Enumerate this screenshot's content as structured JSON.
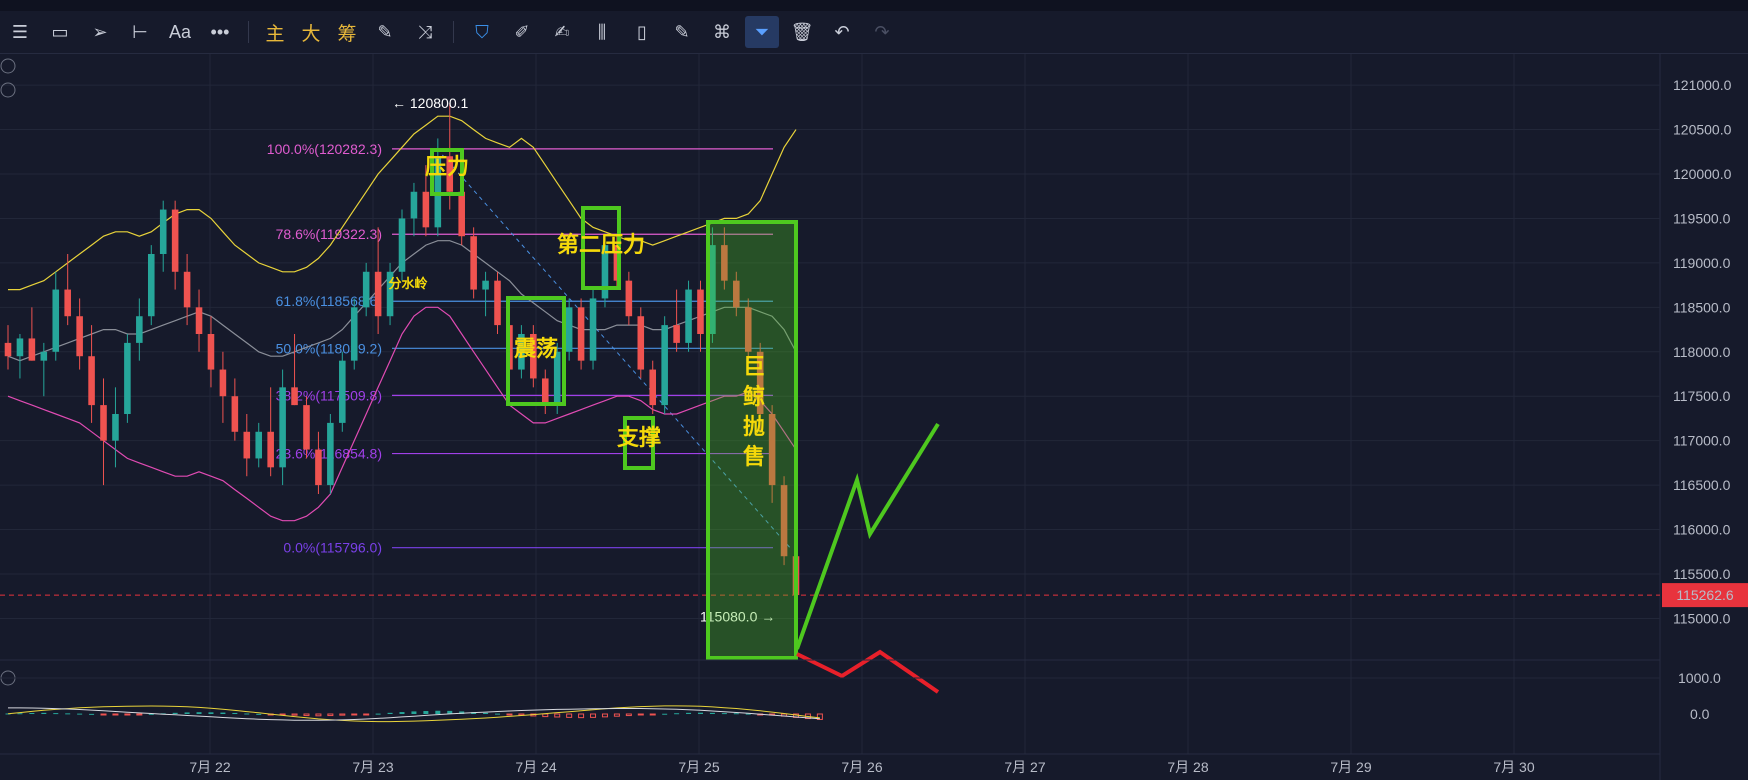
{
  "toolbar": {
    "items": [
      {
        "icon": "menu-icon",
        "glyph": "☰"
      },
      {
        "icon": "rectangle-icon",
        "glyph": "▭"
      },
      {
        "icon": "cursor-icon",
        "glyph": "➢"
      },
      {
        "icon": "horizontal-line-icon",
        "glyph": "⊢"
      },
      {
        "icon": "text-tool-icon",
        "glyph": "Aa"
      },
      {
        "icon": "more-icon",
        "glyph": "•••"
      }
    ],
    "cn_items": [
      {
        "icon": "main-indicator-icon",
        "glyph": "主"
      },
      {
        "icon": "large-indicator-icon",
        "glyph": "大"
      },
      {
        "icon": "chips-indicator-icon",
        "glyph": "筹"
      }
    ],
    "tools": [
      {
        "icon": "edit-indicator-icon",
        "glyph": "✎",
        "state": "normal"
      },
      {
        "icon": "draw-tool-icon",
        "glyph": "⤨",
        "state": "normal"
      },
      {
        "icon": "bookmark-icon",
        "glyph": "⛉",
        "state": "blue"
      },
      {
        "icon": "ruler-icon",
        "glyph": "✐",
        "state": "normal"
      },
      {
        "icon": "pen-icon",
        "glyph": "✍",
        "state": "normal"
      },
      {
        "icon": "candles-icon",
        "glyph": "⫼",
        "state": "normal"
      },
      {
        "icon": "clipboard-icon",
        "glyph": "▯",
        "state": "normal"
      },
      {
        "icon": "note-icon",
        "glyph": "✎",
        "state": "normal"
      },
      {
        "icon": "magnet-icon",
        "glyph": "⌘",
        "state": "normal"
      },
      {
        "icon": "filter-icon",
        "glyph": "⏷",
        "state": "active"
      },
      {
        "icon": "trash-icon",
        "glyph": "🗑",
        "state": "normal"
      },
      {
        "icon": "undo-icon",
        "glyph": "↶",
        "state": "normal"
      },
      {
        "icon": "redo-icon",
        "glyph": "↷",
        "state": "dim"
      }
    ]
  },
  "colors": {
    "bg": "#161a2b",
    "grid": "#222739",
    "up": "#26a69a",
    "down": "#ef5350",
    "boll_upper": "#e8d33a",
    "boll_mid": "#8b8f99",
    "boll_lower": "#e04bb3",
    "annot_box": "#4ec81f",
    "annot_text": "#f5d90a",
    "red_path": "#e8202a",
    "price_tag": "#e8333d"
  },
  "chart_data": {
    "type": "candlestick",
    "ylim": [
      114600,
      121350
    ],
    "yticks": [
      115000.0,
      115500.0,
      116000.0,
      116500.0,
      117000.0,
      117500.0,
      118000.0,
      118500.0,
      119000.0,
      119500.0,
      120000.0,
      120500.0,
      121000.0
    ],
    "ytick_labels": [
      "115000.0",
      "115500.0",
      "116000.0",
      "116500.0",
      "117000.0",
      "117500.0",
      "118000.0",
      "118500.0",
      "119000.0",
      "119500.0",
      "120000.0",
      "120500.0",
      "121000.0"
    ],
    "x_tick_labels": [
      "7月 22",
      "7月 23",
      "7月 24",
      "7月 25",
      "7月 26",
      "7月 27",
      "7月 28",
      "7月 29",
      "7月 30"
    ],
    "last_price": "115262.6",
    "last_price_value": 115262.6,
    "high_label": "← 120800.1",
    "high_value": 120800.1,
    "low_label": "115080.0 →",
    "low_value": 115080.0,
    "fib_levels": [
      {
        "label": "100.0%(120282.3)",
        "value": 120282.3,
        "color": "#e05cd0"
      },
      {
        "label": "78.6%(119322.3)",
        "value": 119322.3,
        "color": "#e05cd0"
      },
      {
        "label": "61.8%(118568.6)",
        "value": 118568.6,
        "color": "#4a90e2"
      },
      {
        "label": "50.0%(118039.2)",
        "value": 118039.2,
        "color": "#4a90e2"
      },
      {
        "label": "38.2%(117509.8)",
        "value": 117509.8,
        "color": "#a040e8"
      },
      {
        "label": "23.6%(116854.8)",
        "value": 116854.8,
        "color": "#a040e8"
      },
      {
        "label": "0.0%(115796.0)",
        "value": 115796.0,
        "color": "#7a40e8"
      }
    ],
    "annotations": {
      "pressure": "压力",
      "second_pressure": "第二压力",
      "watershed": "分水岭",
      "oscillation": "震荡",
      "support": "支撑",
      "whale_chars": [
        "巨",
        "鲸",
        "抛",
        "售"
      ]
    },
    "candles": [
      {
        "o": 118100,
        "h": 118300,
        "l": 117800,
        "c": 117950
      },
      {
        "o": 117950,
        "h": 118200,
        "l": 117700,
        "c": 118150
      },
      {
        "o": 118150,
        "h": 118500,
        "l": 117900,
        "c": 117900
      },
      {
        "o": 117900,
        "h": 118100,
        "l": 117500,
        "c": 118000
      },
      {
        "o": 118000,
        "h": 118900,
        "l": 117900,
        "c": 118700
      },
      {
        "o": 118700,
        "h": 119100,
        "l": 118300,
        "c": 118400
      },
      {
        "o": 118400,
        "h": 118600,
        "l": 117800,
        "c": 117950
      },
      {
        "o": 117950,
        "h": 118300,
        "l": 117200,
        "c": 117400
      },
      {
        "o": 117400,
        "h": 117700,
        "l": 116500,
        "c": 117000
      },
      {
        "o": 117000,
        "h": 117600,
        "l": 116700,
        "c": 117300
      },
      {
        "o": 117300,
        "h": 118200,
        "l": 117200,
        "c": 118100
      },
      {
        "o": 118100,
        "h": 118600,
        "l": 117900,
        "c": 118400
      },
      {
        "o": 118400,
        "h": 119200,
        "l": 118300,
        "c": 119100
      },
      {
        "o": 119100,
        "h": 119700,
        "l": 118900,
        "c": 119600
      },
      {
        "o": 119600,
        "h": 119700,
        "l": 118700,
        "c": 118900
      },
      {
        "o": 118900,
        "h": 119100,
        "l": 118300,
        "c": 118500
      },
      {
        "o": 118500,
        "h": 118700,
        "l": 118000,
        "c": 118200
      },
      {
        "o": 118200,
        "h": 118400,
        "l": 117600,
        "c": 117800
      },
      {
        "o": 117800,
        "h": 118000,
        "l": 117200,
        "c": 117500
      },
      {
        "o": 117500,
        "h": 117700,
        "l": 117000,
        "c": 117100
      },
      {
        "o": 117100,
        "h": 117300,
        "l": 116600,
        "c": 116800
      },
      {
        "o": 116800,
        "h": 117200,
        "l": 116700,
        "c": 117100
      },
      {
        "o": 117100,
        "h": 117600,
        "l": 116600,
        "c": 116700
      },
      {
        "o": 116700,
        "h": 117800,
        "l": 116500,
        "c": 117600
      },
      {
        "o": 117600,
        "h": 118200,
        "l": 117400,
        "c": 117400
      },
      {
        "o": 117400,
        "h": 117500,
        "l": 116800,
        "c": 116900
      },
      {
        "o": 116900,
        "h": 117100,
        "l": 116400,
        "c": 116500
      },
      {
        "o": 116500,
        "h": 117300,
        "l": 116400,
        "c": 117200
      },
      {
        "o": 117200,
        "h": 118000,
        "l": 117100,
        "c": 117900
      },
      {
        "o": 117900,
        "h": 118600,
        "l": 117800,
        "c": 118500
      },
      {
        "o": 118500,
        "h": 119000,
        "l": 118400,
        "c": 118900
      },
      {
        "o": 118900,
        "h": 119400,
        "l": 118200,
        "c": 118400
      },
      {
        "o": 118400,
        "h": 119000,
        "l": 118300,
        "c": 118900
      },
      {
        "o": 118900,
        "h": 119600,
        "l": 118800,
        "c": 119500
      },
      {
        "o": 119500,
        "h": 119900,
        "l": 119300,
        "c": 119800
      },
      {
        "o": 119800,
        "h": 120100,
        "l": 119300,
        "c": 119400
      },
      {
        "o": 119400,
        "h": 120400,
        "l": 119300,
        "c": 120200
      },
      {
        "o": 120200,
        "h": 120800,
        "l": 119600,
        "c": 119800
      },
      {
        "o": 119800,
        "h": 119900,
        "l": 119200,
        "c": 119300
      },
      {
        "o": 119300,
        "h": 119400,
        "l": 118600,
        "c": 118700
      },
      {
        "o": 118700,
        "h": 118900,
        "l": 118400,
        "c": 118800
      },
      {
        "o": 118800,
        "h": 118900,
        "l": 118200,
        "c": 118300
      },
      {
        "o": 118300,
        "h": 118400,
        "l": 117700,
        "c": 117800
      },
      {
        "o": 117800,
        "h": 118300,
        "l": 117700,
        "c": 118200
      },
      {
        "o": 118200,
        "h": 118300,
        "l": 117600,
        "c": 117700
      },
      {
        "o": 117700,
        "h": 117800,
        "l": 117300,
        "c": 117400
      },
      {
        "o": 117400,
        "h": 118100,
        "l": 117300,
        "c": 118000
      },
      {
        "o": 118000,
        "h": 118600,
        "l": 117900,
        "c": 118500
      },
      {
        "o": 118500,
        "h": 118600,
        "l": 117800,
        "c": 117900
      },
      {
        "o": 117900,
        "h": 118700,
        "l": 117800,
        "c": 118600
      },
      {
        "o": 118600,
        "h": 119300,
        "l": 118500,
        "c": 119200
      },
      {
        "o": 119200,
        "h": 119300,
        "l": 118700,
        "c": 118800
      },
      {
        "o": 118800,
        "h": 118900,
        "l": 118300,
        "c": 118400
      },
      {
        "o": 118400,
        "h": 118500,
        "l": 117700,
        "c": 117800
      },
      {
        "o": 117800,
        "h": 117900,
        "l": 117300,
        "c": 117400
      },
      {
        "o": 117400,
        "h": 118400,
        "l": 117300,
        "c": 118300
      },
      {
        "o": 118300,
        "h": 118700,
        "l": 118000,
        "c": 118100
      },
      {
        "o": 118100,
        "h": 118800,
        "l": 118000,
        "c": 118700
      },
      {
        "o": 118700,
        "h": 118800,
        "l": 118000,
        "c": 118200
      },
      {
        "o": 118200,
        "h": 119400,
        "l": 118100,
        "c": 119200
      },
      {
        "o": 119200,
        "h": 119400,
        "l": 118700,
        "c": 118800
      },
      {
        "o": 118800,
        "h": 118900,
        "l": 118400,
        "c": 118500
      },
      {
        "o": 118500,
        "h": 118600,
        "l": 117900,
        "c": 118000
      },
      {
        "o": 118000,
        "h": 118100,
        "l": 117100,
        "c": 117300
      },
      {
        "o": 117300,
        "h": 117400,
        "l": 116300,
        "c": 116500
      },
      {
        "o": 116500,
        "h": 116600,
        "l": 115600,
        "c": 115700
      },
      {
        "o": 115700,
        "h": 116100,
        "l": 115080,
        "c": 115263
      }
    ],
    "boll_upper": [
      118700,
      118700,
      118750,
      118800,
      118900,
      119000,
      119100,
      119200,
      119300,
      119350,
      119350,
      119300,
      119350,
      119450,
      119550,
      119600,
      119600,
      119500,
      119350,
      119200,
      119100,
      119000,
      118950,
      118900,
      118900,
      118950,
      119050,
      119200,
      119400,
      119600,
      119800,
      120000,
      120150,
      120300,
      120450,
      120550,
      120650,
      120650,
      120600,
      120500,
      120400,
      120350,
      120300,
      120400,
      120300,
      120100,
      119900,
      119700,
      119500,
      119400,
      119350,
      119300,
      119250,
      119250,
      119200,
      119250,
      119300,
      119350,
      119400,
      119450,
      119500,
      119500,
      119550,
      119700,
      120000,
      120300,
      120500
    ],
    "boll_mid": [
      117950,
      117900,
      117950,
      118000,
      118050,
      118100,
      118150,
      118200,
      118250,
      118250,
      118200,
      118200,
      118250,
      118300,
      118350,
      118400,
      118450,
      118400,
      118300,
      118200,
      118100,
      118000,
      117950,
      117950,
      118000,
      118050,
      118100,
      118150,
      118250,
      118400,
      118550,
      118700,
      118850,
      119000,
      119100,
      119200,
      119250,
      119250,
      119200,
      119100,
      119000,
      118900,
      118800,
      118650,
      118550,
      118450,
      118350,
      118300,
      118250,
      118250,
      118250,
      118300,
      118300,
      118300,
      118250,
      118250,
      118300,
      118350,
      118400,
      118450,
      118500,
      118500,
      118500,
      118450,
      118400,
      118250,
      118000
    ],
    "boll_lower": [
      117500,
      117450,
      117400,
      117350,
      117300,
      117250,
      117200,
      117100,
      117000,
      116900,
      116800,
      116750,
      116700,
      116650,
      116600,
      116600,
      116650,
      116600,
      116550,
      116450,
      116350,
      116250,
      116150,
      116100,
      116100,
      116150,
      116250,
      116400,
      116700,
      117000,
      117300,
      117600,
      117900,
      118200,
      118400,
      118500,
      118500,
      118400,
      118200,
      118000,
      117800,
      117600,
      117400,
      117300,
      117200,
      117200,
      117250,
      117300,
      117350,
      117400,
      117450,
      117500,
      117500,
      117450,
      117350,
      117300,
      117300,
      117350,
      117400,
      117450,
      117500,
      117500,
      117550,
      117450,
      117300,
      117100,
      116900
    ],
    "macd_hist": [
      40,
      60,
      80,
      90,
      70,
      50,
      30,
      10,
      -20,
      -40,
      -60,
      -30,
      10,
      50,
      90,
      120,
      140,
      130,
      110,
      80,
      40,
      10,
      -30,
      -60,
      -90,
      -120,
      -140,
      -120,
      -90,
      -60,
      -20,
      30,
      90,
      150,
      200,
      230,
      250,
      240,
      200,
      150,
      90,
      30,
      -30,
      -90,
      -150,
      -200,
      -230,
      -260,
      -280,
      -260,
      -220,
      -170,
      -120,
      -70,
      -20,
      20,
      60,
      90,
      100,
      90,
      70,
      60,
      30,
      -20,
      -80,
      -160,
      -260,
      -350,
      -420
    ]
  }
}
